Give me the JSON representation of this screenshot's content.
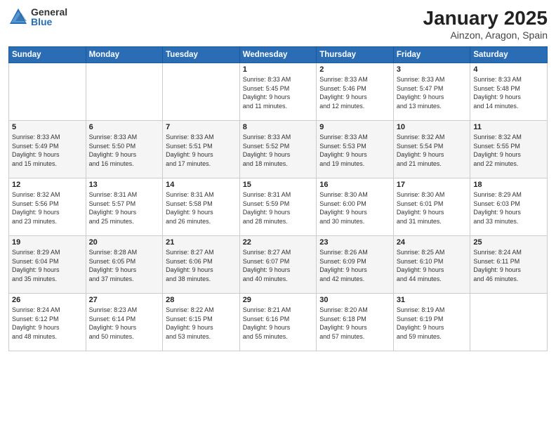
{
  "logo": {
    "general": "General",
    "blue": "Blue"
  },
  "title": "January 2025",
  "subtitle": "Ainzon, Aragon, Spain",
  "days": [
    "Sunday",
    "Monday",
    "Tuesday",
    "Wednesday",
    "Thursday",
    "Friday",
    "Saturday"
  ],
  "weeks": [
    [
      {
        "day": "",
        "text": ""
      },
      {
        "day": "",
        "text": ""
      },
      {
        "day": "",
        "text": ""
      },
      {
        "day": "1",
        "text": "Sunrise: 8:33 AM\nSunset: 5:45 PM\nDaylight: 9 hours\nand 11 minutes."
      },
      {
        "day": "2",
        "text": "Sunrise: 8:33 AM\nSunset: 5:46 PM\nDaylight: 9 hours\nand 12 minutes."
      },
      {
        "day": "3",
        "text": "Sunrise: 8:33 AM\nSunset: 5:47 PM\nDaylight: 9 hours\nand 13 minutes."
      },
      {
        "day": "4",
        "text": "Sunrise: 8:33 AM\nSunset: 5:48 PM\nDaylight: 9 hours\nand 14 minutes."
      }
    ],
    [
      {
        "day": "5",
        "text": "Sunrise: 8:33 AM\nSunset: 5:49 PM\nDaylight: 9 hours\nand 15 minutes."
      },
      {
        "day": "6",
        "text": "Sunrise: 8:33 AM\nSunset: 5:50 PM\nDaylight: 9 hours\nand 16 minutes."
      },
      {
        "day": "7",
        "text": "Sunrise: 8:33 AM\nSunset: 5:51 PM\nDaylight: 9 hours\nand 17 minutes."
      },
      {
        "day": "8",
        "text": "Sunrise: 8:33 AM\nSunset: 5:52 PM\nDaylight: 9 hours\nand 18 minutes."
      },
      {
        "day": "9",
        "text": "Sunrise: 8:33 AM\nSunset: 5:53 PM\nDaylight: 9 hours\nand 19 minutes."
      },
      {
        "day": "10",
        "text": "Sunrise: 8:32 AM\nSunset: 5:54 PM\nDaylight: 9 hours\nand 21 minutes."
      },
      {
        "day": "11",
        "text": "Sunrise: 8:32 AM\nSunset: 5:55 PM\nDaylight: 9 hours\nand 22 minutes."
      }
    ],
    [
      {
        "day": "12",
        "text": "Sunrise: 8:32 AM\nSunset: 5:56 PM\nDaylight: 9 hours\nand 23 minutes."
      },
      {
        "day": "13",
        "text": "Sunrise: 8:31 AM\nSunset: 5:57 PM\nDaylight: 9 hours\nand 25 minutes."
      },
      {
        "day": "14",
        "text": "Sunrise: 8:31 AM\nSunset: 5:58 PM\nDaylight: 9 hours\nand 26 minutes."
      },
      {
        "day": "15",
        "text": "Sunrise: 8:31 AM\nSunset: 5:59 PM\nDaylight: 9 hours\nand 28 minutes."
      },
      {
        "day": "16",
        "text": "Sunrise: 8:30 AM\nSunset: 6:00 PM\nDaylight: 9 hours\nand 30 minutes."
      },
      {
        "day": "17",
        "text": "Sunrise: 8:30 AM\nSunset: 6:01 PM\nDaylight: 9 hours\nand 31 minutes."
      },
      {
        "day": "18",
        "text": "Sunrise: 8:29 AM\nSunset: 6:03 PM\nDaylight: 9 hours\nand 33 minutes."
      }
    ],
    [
      {
        "day": "19",
        "text": "Sunrise: 8:29 AM\nSunset: 6:04 PM\nDaylight: 9 hours\nand 35 minutes."
      },
      {
        "day": "20",
        "text": "Sunrise: 8:28 AM\nSunset: 6:05 PM\nDaylight: 9 hours\nand 37 minutes."
      },
      {
        "day": "21",
        "text": "Sunrise: 8:27 AM\nSunset: 6:06 PM\nDaylight: 9 hours\nand 38 minutes."
      },
      {
        "day": "22",
        "text": "Sunrise: 8:27 AM\nSunset: 6:07 PM\nDaylight: 9 hours\nand 40 minutes."
      },
      {
        "day": "23",
        "text": "Sunrise: 8:26 AM\nSunset: 6:09 PM\nDaylight: 9 hours\nand 42 minutes."
      },
      {
        "day": "24",
        "text": "Sunrise: 8:25 AM\nSunset: 6:10 PM\nDaylight: 9 hours\nand 44 minutes."
      },
      {
        "day": "25",
        "text": "Sunrise: 8:24 AM\nSunset: 6:11 PM\nDaylight: 9 hours\nand 46 minutes."
      }
    ],
    [
      {
        "day": "26",
        "text": "Sunrise: 8:24 AM\nSunset: 6:12 PM\nDaylight: 9 hours\nand 48 minutes."
      },
      {
        "day": "27",
        "text": "Sunrise: 8:23 AM\nSunset: 6:14 PM\nDaylight: 9 hours\nand 50 minutes."
      },
      {
        "day": "28",
        "text": "Sunrise: 8:22 AM\nSunset: 6:15 PM\nDaylight: 9 hours\nand 53 minutes."
      },
      {
        "day": "29",
        "text": "Sunrise: 8:21 AM\nSunset: 6:16 PM\nDaylight: 9 hours\nand 55 minutes."
      },
      {
        "day": "30",
        "text": "Sunrise: 8:20 AM\nSunset: 6:18 PM\nDaylight: 9 hours\nand 57 minutes."
      },
      {
        "day": "31",
        "text": "Sunrise: 8:19 AM\nSunset: 6:19 PM\nDaylight: 9 hours\nand 59 minutes."
      },
      {
        "day": "",
        "text": ""
      }
    ]
  ]
}
